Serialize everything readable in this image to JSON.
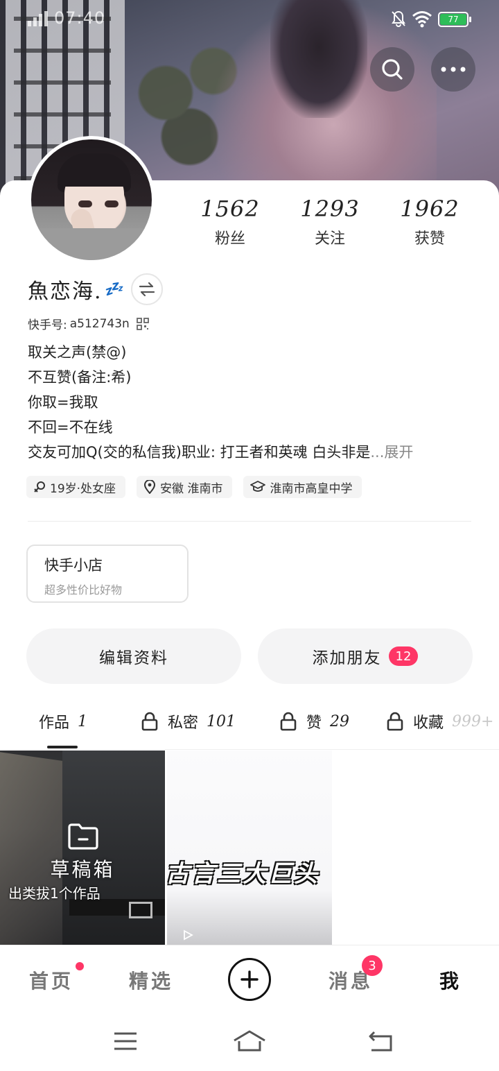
{
  "status_bar": {
    "time": "07:40",
    "battery": "77"
  },
  "profile": {
    "name": "魚恋海.",
    "name_suffix": "💤",
    "kuaishou_id_label": "快手号:",
    "kuaishou_id": "a512743n",
    "bio_lines": [
      "取关之声(禁@)",
      "不互赞(备注:希)",
      "你取=我取",
      "不回=不在线",
      "交友可加Q(交的私信我)职业: 打王者和英魂 白头非是"
    ],
    "bio_expand": "...展开",
    "tags": [
      {
        "icon": "female-icon",
        "text": "19岁·处女座"
      },
      {
        "icon": "location-icon",
        "text": "安徽 淮南市"
      },
      {
        "icon": "school-icon",
        "text": "淮南市高皇中学"
      }
    ]
  },
  "stats": [
    {
      "value": "1562",
      "label": "粉丝"
    },
    {
      "value": "1293",
      "label": "关注"
    },
    {
      "value": "1962",
      "label": "获赞"
    }
  ],
  "shop": {
    "title": "快手小店",
    "subtitle": "超多性价比好物"
  },
  "actions": {
    "edit": "编辑资料",
    "add_friend": "添加朋友",
    "add_friend_badge": "12"
  },
  "tabs": [
    {
      "label": "作品",
      "count": "1",
      "locked": false,
      "active": true
    },
    {
      "label": "私密",
      "count": "101",
      "locked": true
    },
    {
      "label": "赞",
      "count": "29",
      "locked": true
    },
    {
      "label": "收藏",
      "count": "999+",
      "locked": true
    }
  ],
  "works": {
    "drafts_title": "草稿箱",
    "drafts_sub": "出类拔1个作品",
    "video_caption": "古言三大巨头"
  },
  "bottom_nav": {
    "home": "首页",
    "featured": "精选",
    "messages": "消息",
    "messages_badge": "3",
    "me": "我"
  },
  "colors": {
    "accent": "#fe3666",
    "battery": "#2ebd59"
  }
}
